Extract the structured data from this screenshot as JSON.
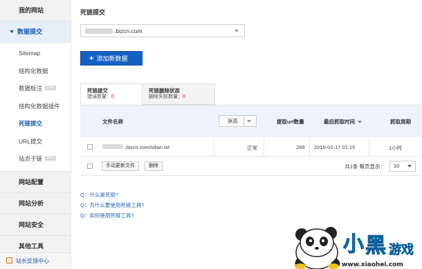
{
  "sidebar": {
    "sections": [
      {
        "label": "我的网站"
      },
      {
        "label": "数据提交"
      },
      {
        "label": "网站配置"
      },
      {
        "label": "网站分析"
      },
      {
        "label": "网站安全"
      },
      {
        "label": "其他工具"
      }
    ],
    "sub_items": [
      {
        "label": "Sitemap",
        "beta": ""
      },
      {
        "label": "结构化数据",
        "beta": ""
      },
      {
        "label": "数据标注",
        "beta": "Beta"
      },
      {
        "label": "结构化数据插件",
        "beta": ""
      },
      {
        "label": "死链提交",
        "beta": ""
      },
      {
        "label": "URL提交",
        "beta": ""
      },
      {
        "label": "站点子链",
        "beta": "Beta"
      }
    ],
    "feedback": "站长反馈中心"
  },
  "main": {
    "title": "死链提交",
    "site_select_value": ".bizcn.com",
    "add_button": "添加新数据",
    "add_button_icon": "+"
  },
  "tabs": [
    {
      "title": "死链提交",
      "sub_label": "错误数量：",
      "sub_value": "0"
    },
    {
      "title": "死链删除状态",
      "sub_label": "删除失败数量：",
      "sub_value": "0"
    }
  ],
  "table": {
    "headers": {
      "file": "文件名称",
      "state": "状态",
      "count": "提取url数量",
      "last_fetch": "最后抓取时间",
      "period": "抓取周期"
    },
    "rows": [
      {
        "file": ".bizcn.com/silian.txt",
        "state": "正常",
        "count": "289",
        "last_fetch": "2015-02-17 01:15",
        "period": "1小时"
      }
    ],
    "footer": {
      "manual_update": "手动更新文件",
      "delete": "删除",
      "pager_text": "共1条 每页显示：",
      "page_size": "10"
    }
  },
  "faq": [
    "Q：什么是死链?",
    "Q：为什么要使用死链工具?",
    "Q：如何使用死链工具?"
  ],
  "watermark": {
    "brand": "小黑游戏",
    "url": "www.xiaohei.com"
  }
}
